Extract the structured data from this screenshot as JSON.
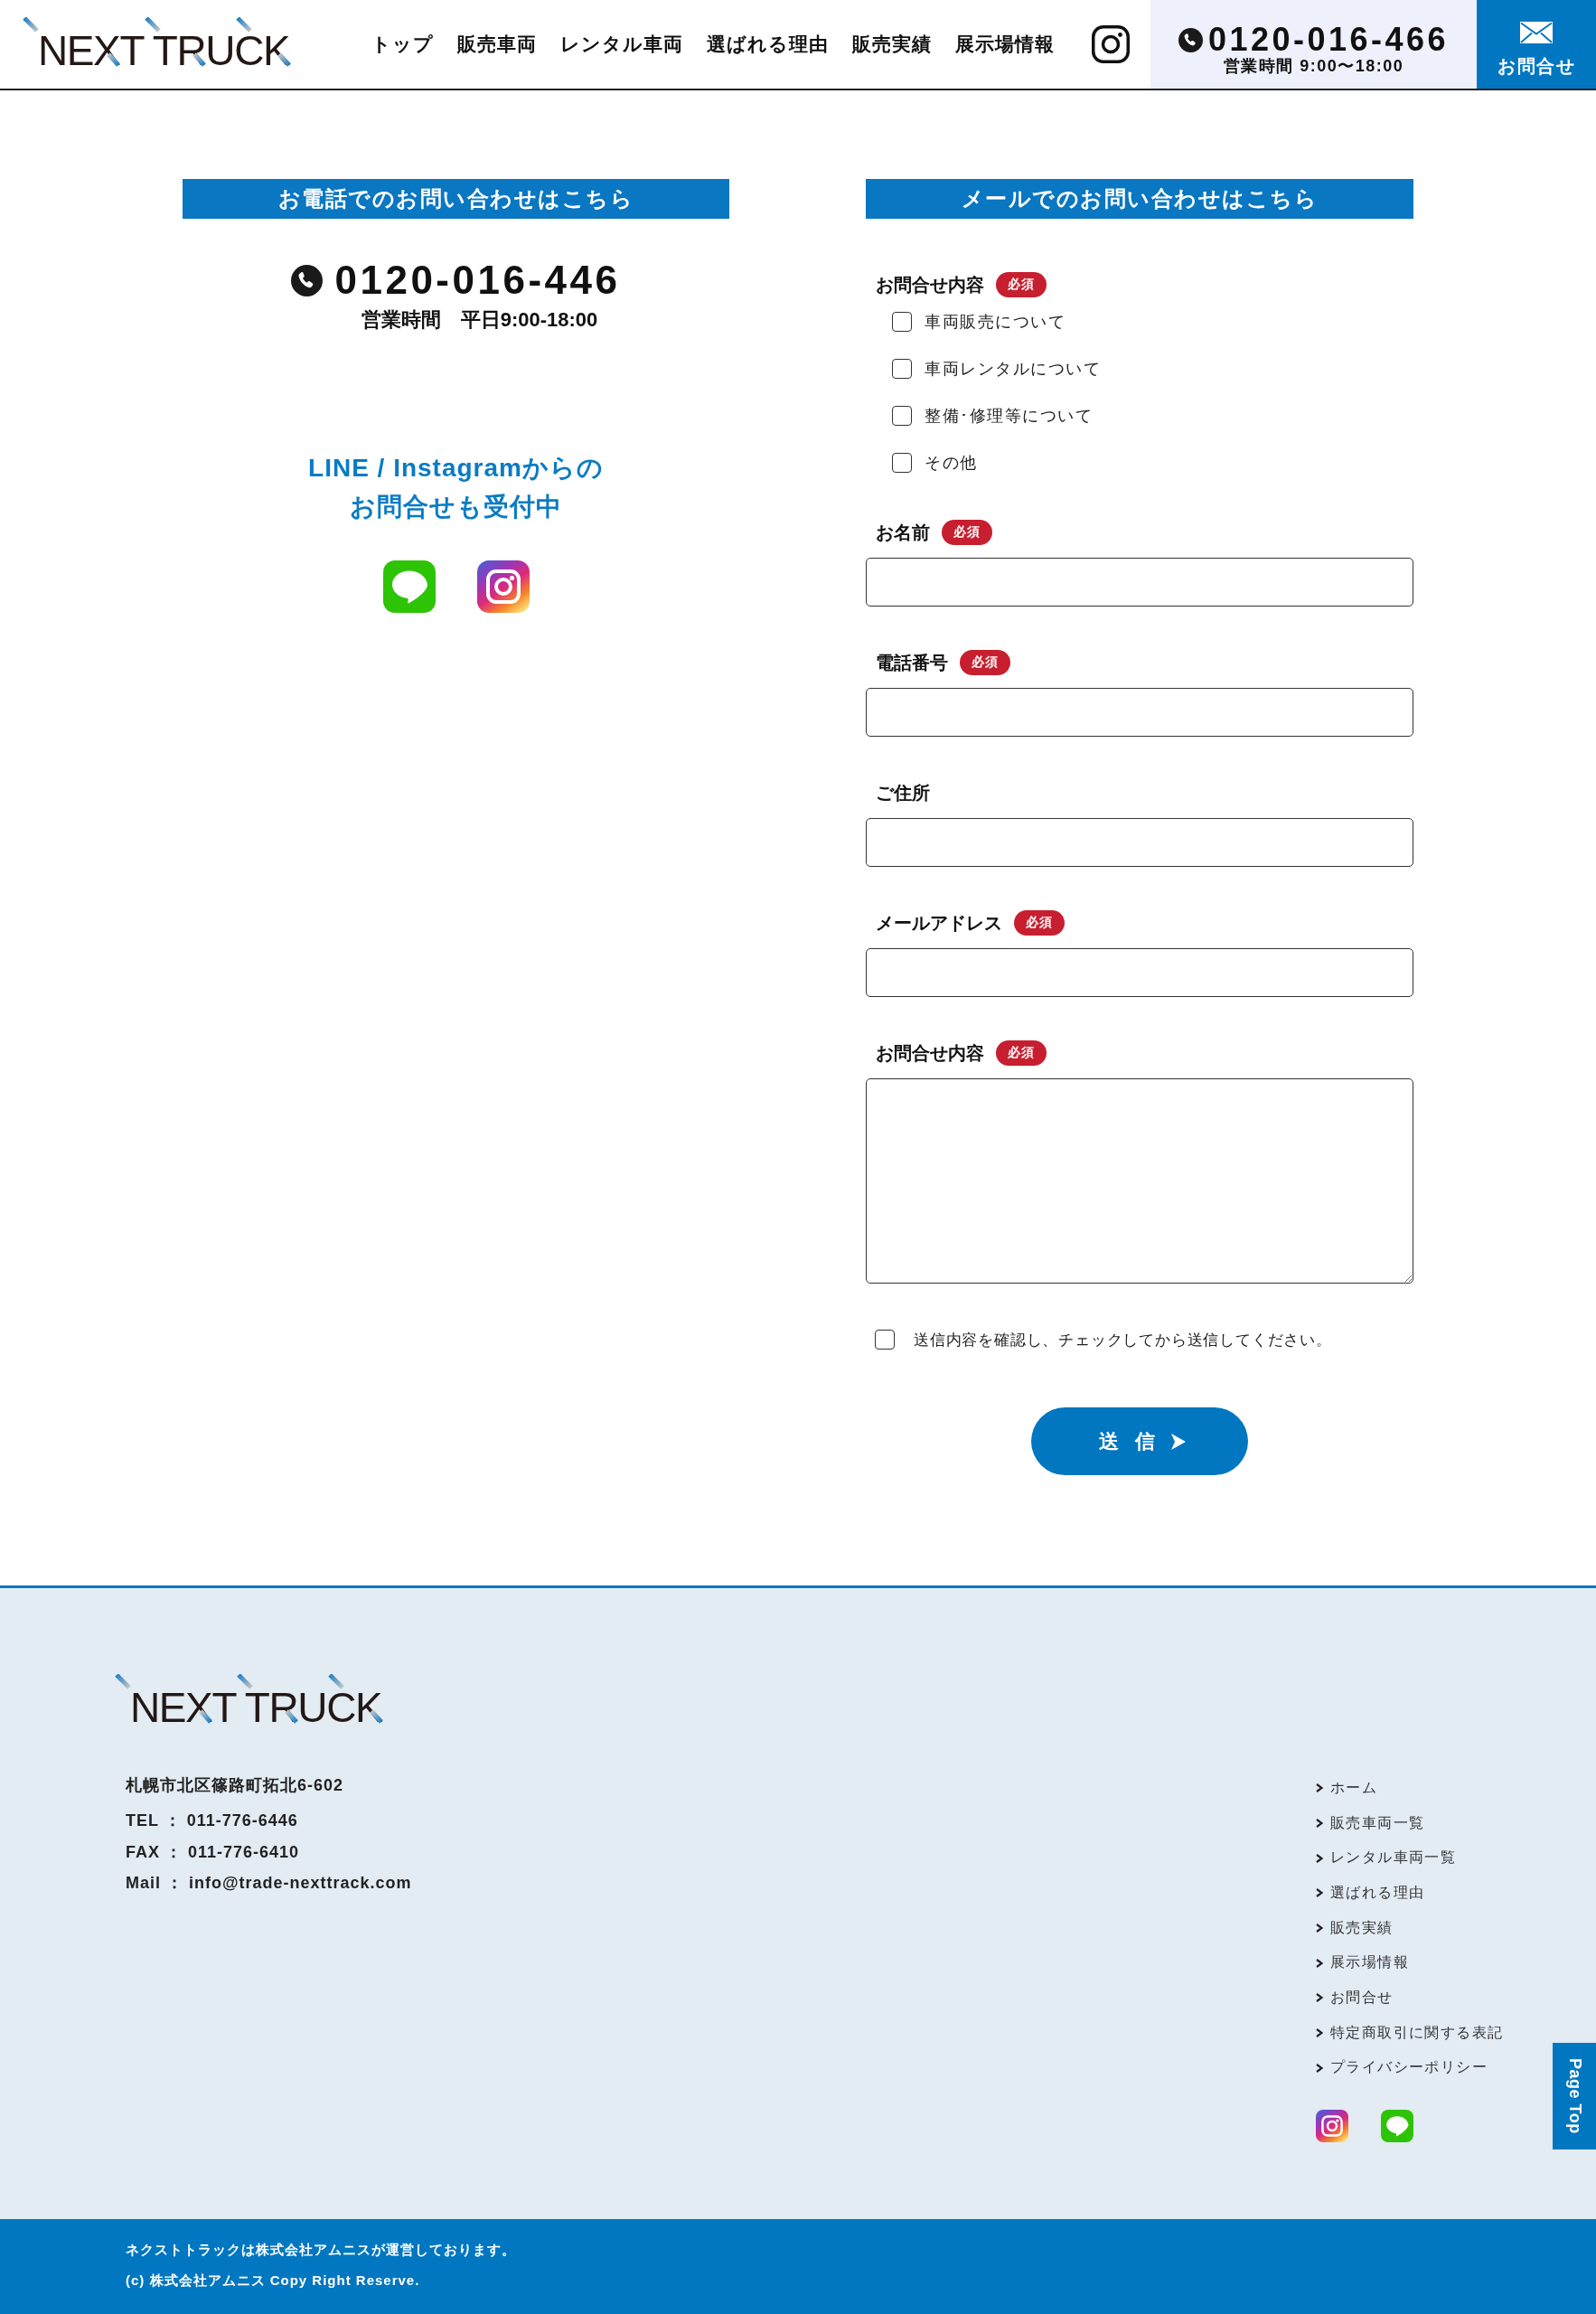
{
  "header": {
    "logo": "NEXT TRUCK",
    "nav": [
      "トップ",
      "販売車両",
      "レンタル車両",
      "選ばれる理由",
      "販売実績",
      "展示場情報"
    ],
    "phone": {
      "number": "0120-016-466",
      "hours": "営業時間 9:00〜18:00"
    },
    "contact_button": "お問合せ"
  },
  "phone_section": {
    "heading": "お電話でのお問い合わせはこちら",
    "number": "0120-016-446",
    "hours": "営業時間　平日9:00-18:00",
    "sns_lines": [
      "LINE / Instagramからの",
      "お問合せも受付中"
    ]
  },
  "mail_section": {
    "heading": "メールでのお問い合わせはこちら",
    "fields": [
      {
        "kind": "checkboxes",
        "label": "お問合せ内容",
        "badge": "必須",
        "options": [
          {
            "label": "車両販売について",
            "checked": false
          },
          {
            "label": "車両レンタルについて",
            "checked": false
          },
          {
            "label": "整備･修理等について",
            "checked": false
          },
          {
            "label": "その他",
            "checked": false
          }
        ]
      },
      {
        "kind": "text",
        "label": "お名前",
        "badge": "必須"
      },
      {
        "kind": "text",
        "label": "電話番号",
        "badge": "必須"
      },
      {
        "kind": "text",
        "label": "ご住所"
      },
      {
        "kind": "text",
        "label": "メールアドレス",
        "badge": "必須"
      },
      {
        "kind": "textarea",
        "label": "お問合せ内容",
        "badge": "必須"
      }
    ],
    "confirm": {
      "label": "送信内容を確認し、チェックしてから送信してください。",
      "checked": false
    },
    "submit": "送 信"
  },
  "footer": {
    "logo": "NEXT TRUCK",
    "address": "札幌市北区篠路町拓北6-602",
    "contact_lines": [
      "TEL ： 011-776-6446",
      "FAX ： 011-776-6410",
      "Mail ： info@trade-nexttrack.com"
    ],
    "links": [
      "ホーム",
      "販売車両一覧",
      "レンタル車両一覧",
      "選ばれる理由",
      "販売実績",
      "展示場情報",
      "お問合せ",
      "特定商取引に関する表記",
      "プライバシーポリシー"
    ]
  },
  "page_top": "Page Top",
  "bottom_bar": {
    "operator": "ネクストトラックは株式会社アムニスが運営しております。",
    "copyright": "(c) 株式会社アムニス Copy Right Reserve."
  }
}
